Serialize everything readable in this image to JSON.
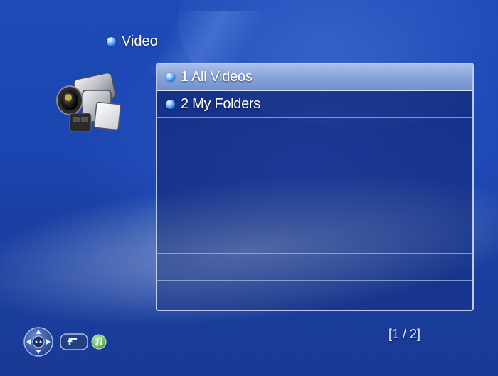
{
  "header": {
    "title": "Video",
    "icon": "video-camera-icon"
  },
  "list": {
    "items": [
      {
        "label": "1 All Videos",
        "selected": true
      },
      {
        "label": "2 My Folders",
        "selected": false
      }
    ],
    "selected_index": 0
  },
  "footer": {
    "controls": [
      "dpad-icon",
      "return-icon",
      "music-icon"
    ],
    "page_indicator": "[1 / 2]"
  },
  "colors": {
    "background": "#1e4ab8",
    "panel_border": "#cddcf5",
    "selected_row": "#8aa6da",
    "bullet": "#2e86e6"
  }
}
